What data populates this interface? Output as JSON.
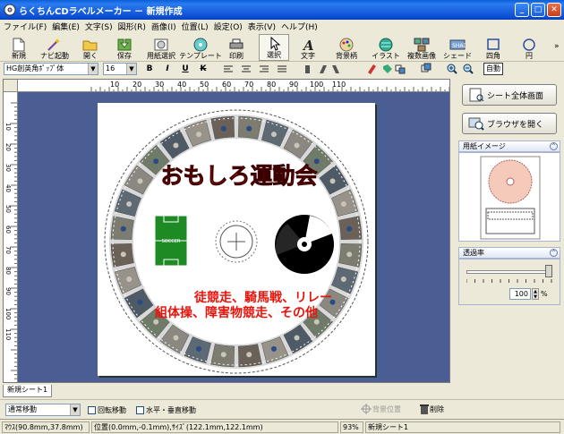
{
  "window": {
    "title": "らくちんCDラベルメーカー － 新規作成"
  },
  "menu": [
    "ファイル(F)",
    "編集(E)",
    "文字(S)",
    "図形(R)",
    "画像(I)",
    "位置(L)",
    "設定(O)",
    "表示(V)",
    "ヘルプ(H)"
  ],
  "toolbar": {
    "new": "新規",
    "navi": "ナビ起動",
    "open": "開く",
    "save": "保存",
    "paper_select": "用紙選択",
    "template": "テンプレート",
    "print": "印刷",
    "select": "選択",
    "text": "文字",
    "background": "背景柄",
    "illust": "イラスト",
    "multi_image": "複数画像",
    "shade": "シェード",
    "rect": "四角",
    "circle": "円"
  },
  "format": {
    "font": "HG創英角ﾎﾟｯﾌﾟ体",
    "size": "16",
    "bold": "B",
    "italic": "I",
    "underline": "U",
    "strike": "K",
    "auto": "自動"
  },
  "ruler": {
    "h": [
      "10",
      "20",
      "30",
      "40",
      "50",
      "60",
      "70",
      "80",
      "90",
      "100",
      "110"
    ],
    "v": [
      "10",
      "20",
      "30",
      "40",
      "50",
      "60",
      "70",
      "80",
      "90",
      "100",
      "110"
    ]
  },
  "label": {
    "title": "おもしろ運動会",
    "line1": "徒競走、騎馬戦、リレー",
    "line2": "組体操、障害物競走、その他",
    "field_sign": "SOCCER"
  },
  "side": {
    "whole_sheet": "シート全体画面",
    "browser": "ブラウザを開く",
    "paper_image": "用紙イメージ",
    "transparency": "透過率",
    "transparency_value": "100",
    "percent": "%"
  },
  "tabs": {
    "sheet1": "新規シート1"
  },
  "bottom": {
    "mode": "通常移動",
    "rotate": "回転移動",
    "hv": "水平・垂直移動",
    "bg_pos": "背景位置",
    "delete": "削除"
  },
  "status": {
    "mouse": "ﾏｳｽ(90.8mm,37.8mm)",
    "position": "位置(0.0mm,-0.1mm),ｻｲｽﾞ(122.1mm,122.1mm)",
    "zoom": "93%",
    "sheet": "新規シート1"
  },
  "colors": {
    "title_red": "#e8140c",
    "title_bar": "#0c4fd4",
    "paper_bg": "#4a5e94",
    "label_pink": "#f6cabb"
  }
}
